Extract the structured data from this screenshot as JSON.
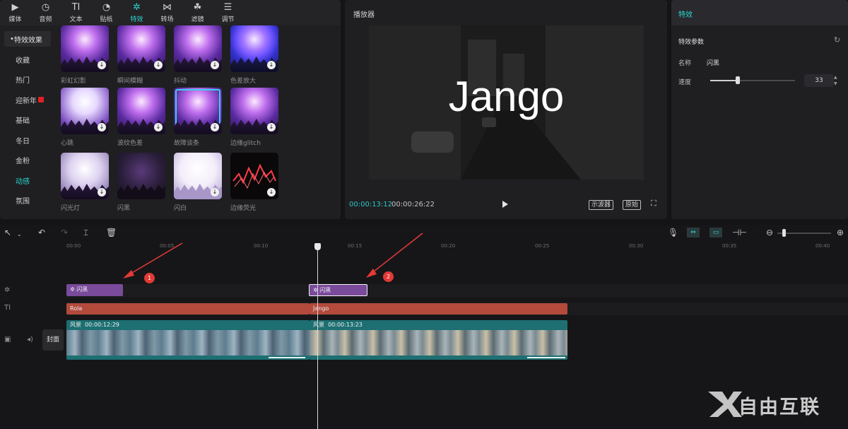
{
  "top_tabs": [
    {
      "label": "媒体",
      "icon": "media-icon"
    },
    {
      "label": "音频",
      "icon": "audio-icon"
    },
    {
      "label": "文本",
      "icon": "text-icon"
    },
    {
      "label": "贴纸",
      "icon": "sticker-icon"
    },
    {
      "label": "特效",
      "icon": "effects-icon",
      "active": true
    },
    {
      "label": "转场",
      "icon": "transition-icon"
    },
    {
      "label": "滤镜",
      "icon": "filter-icon"
    },
    {
      "label": "调节",
      "icon": "adjust-icon"
    }
  ],
  "categories": [
    "特效效果",
    "收藏",
    "热门",
    "迎新年",
    "基础",
    "冬日",
    "金粉",
    "动感",
    "氛围"
  ],
  "effects": [
    {
      "label": "彩虹幻影",
      "style": "purple"
    },
    {
      "label": "瞬间模糊",
      "style": "purple"
    },
    {
      "label": "抖动",
      "style": "purple"
    },
    {
      "label": "色差放大",
      "style": "purple"
    },
    {
      "label": "心跳",
      "style": "purple"
    },
    {
      "label": "波纹色差",
      "style": "purple"
    },
    {
      "label": "故障谈条",
      "style": "purple"
    },
    {
      "label": "边缘glitch",
      "style": "purple"
    },
    {
      "label": "闪光灯",
      "style": "white"
    },
    {
      "label": "闪黑",
      "style": "dark"
    },
    {
      "label": "闪白",
      "style": "white"
    },
    {
      "label": "边缘荧光",
      "style": "glitch"
    }
  ],
  "player": {
    "title": "播放器",
    "overlay_text": "Jango",
    "current_time": "00:00:13:12",
    "total_time": "00:00:26:22",
    "btn_scope": "示波器",
    "btn_original": "原始"
  },
  "effect_panel": {
    "title": "特效",
    "params_title": "特效参数",
    "name_label": "名称",
    "name_value": "闪黑",
    "speed_label": "速度",
    "speed_value": "33",
    "speed_fraction": 0.33
  },
  "ruler": [
    "00:00",
    "00:05",
    "00:10",
    "00:15",
    "00:20",
    "00:25",
    "00:30",
    "00:35",
    "00:40"
  ],
  "tracks": {
    "effect_clips": [
      "闪黑",
      "闪黑"
    ],
    "text_clips": [
      "Rola",
      "Jango"
    ],
    "video_clips": [
      {
        "name": "风景",
        "duration": "00:00:12:29"
      },
      {
        "name": "风景",
        "duration": "00:00:13:23"
      }
    ],
    "cover_label": "封面"
  },
  "annotations": [
    "1",
    "2"
  ],
  "watermark": "自由互联",
  "colors": {
    "accent": "#2bd5d1",
    "effect_clip": "#7a4a9b",
    "text_clip": "#b34a3c",
    "video_clip": "#1d6f72",
    "arrow": "#e23a36"
  }
}
